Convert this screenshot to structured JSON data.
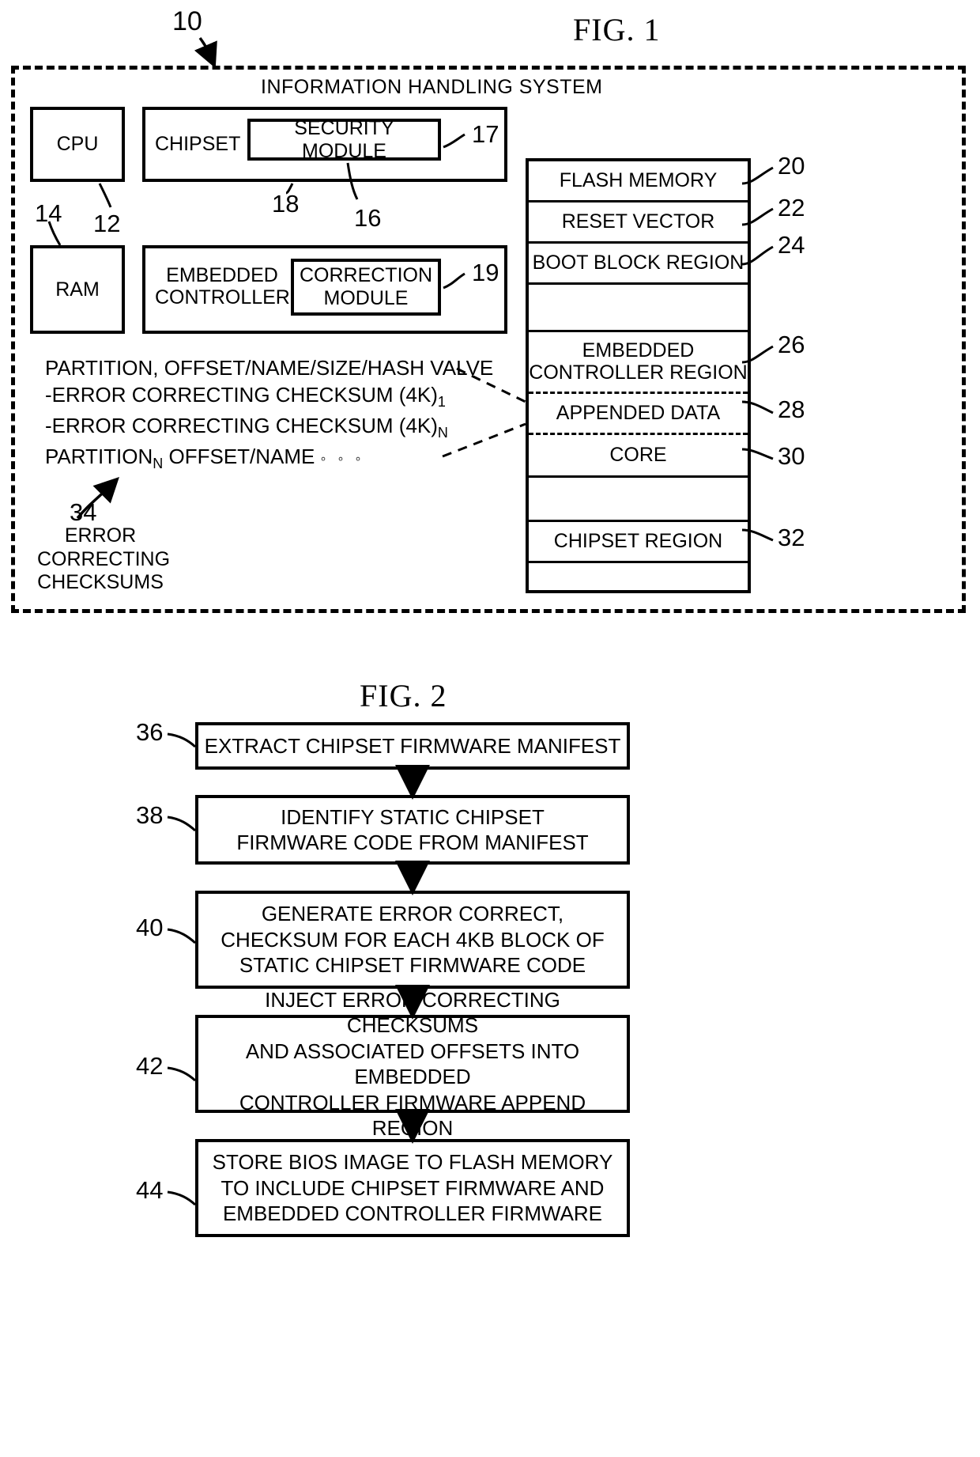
{
  "figures": {
    "fig1": {
      "title": "FIG. 1",
      "system_label": "INFORMATION HANDLING SYSTEM",
      "ref_10": "10",
      "components": {
        "cpu": {
          "label": "CPU",
          "ref": "12",
          "ref_left": "14"
        },
        "ram": {
          "label": "RAM"
        },
        "chipset": {
          "label": "CHIPSET",
          "ref": "18"
        },
        "security_module": {
          "label": "SECURITY MODULE",
          "ref": "17",
          "ref_lead": "16"
        },
        "embedded_controller": {
          "label_line1": "EMBEDDED",
          "label_line2": "CONTROLLER"
        },
        "correction_module": {
          "label_line1": "CORRECTION",
          "label_line2": "MODULE",
          "ref": "19"
        }
      },
      "flash_memory_rows": [
        {
          "label": "FLASH MEMORY",
          "ref": "20",
          "style": "solid"
        },
        {
          "label": "RESET VECTOR",
          "ref": "22",
          "style": "solid"
        },
        {
          "label": "BOOT BLOCK REGION",
          "ref": "24",
          "style": "solid"
        },
        {
          "label": "",
          "ref": "",
          "style": "solid"
        },
        {
          "label": "EMBEDDED CONTROLLER REGION",
          "ref": "26",
          "style": "dashed"
        },
        {
          "label": "APPENDED DATA",
          "ref": "28",
          "style": "dashed"
        },
        {
          "label": "CORE",
          "ref": "30",
          "style": "solid"
        },
        {
          "label": "",
          "ref": "",
          "style": "solid"
        },
        {
          "label": "CHIPSET REGION",
          "ref": "32",
          "style": "solid"
        },
        {
          "label": "",
          "ref": "",
          "style": "none"
        }
      ],
      "manifest": {
        "line1": "PARTITION, OFFSET/NAME/SIZE/HASH VALVE",
        "line2_text": "-ERROR CORRECTING CHECKSUM (4K)",
        "line2_sub": "1",
        "line3_text": "-ERROR CORRECTING CHECKSUM (4K)",
        "line3_sub": "N",
        "line4_text": "PARTITION",
        "line4_sub": "N",
        "line4_rest": " OFFSET/NAME",
        "line4_dots": "◦ ◦ ◦"
      },
      "ecc_caption": {
        "ref": "34",
        "line1": "ERROR",
        "line2": "CORRECTING",
        "line3": "CHECKSUMS"
      }
    },
    "fig2": {
      "title": "FIG. 2",
      "steps": [
        {
          "ref": "36",
          "text": "EXTRACT CHIPSET FIRMWARE MANIFEST"
        },
        {
          "ref": "38",
          "text": "IDENTIFY STATIC CHIPSET\nFIRMWARE CODE FROM MANIFEST"
        },
        {
          "ref": "40",
          "text": "GENERATE ERROR CORRECT,\nCHECKSUM FOR EACH 4KB BLOCK OF\nSTATIC CHIPSET FIRMWARE CODE"
        },
        {
          "ref": "42",
          "text": "INJECT ERROR CORRECTING CHECKSUMS\nAND ASSOCIATED OFFSETS INTO EMBEDDED\nCONTROLLER FIRMWARE APPEND REGION"
        },
        {
          "ref": "44",
          "text": "STORE BIOS IMAGE TO FLASH MEMORY\nTO INCLUDE CHIPSET FIRMWARE AND\nEMBEDDED CONTROLLER FIRMWARE"
        }
      ]
    }
  },
  "colors": {
    "ink": "#000000",
    "paper": "#ffffff"
  }
}
